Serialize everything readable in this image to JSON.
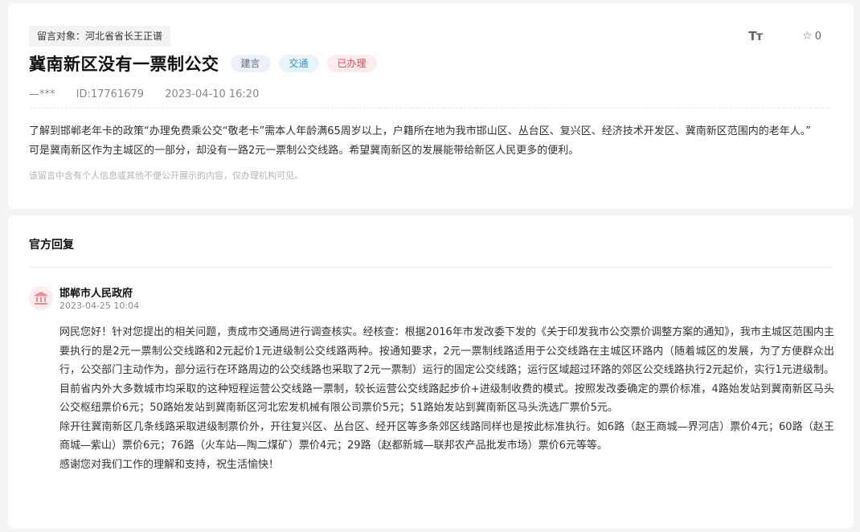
{
  "message": {
    "target": "留言对象：河北省省长王正谱",
    "title": "冀南新区没有一票制公交",
    "tags": {
      "type": "建言",
      "category": "交通",
      "status": "已办理"
    },
    "font_tool_label": "Tт",
    "favorite_count": "0",
    "author": "—***",
    "id": "ID:17761679",
    "time": "2023-04-10 16:20",
    "content": [
      "了解到邯郸老年卡的政策“办理免费乘公交“敬老卡”需本人年龄满65周岁以上，户籍所在地为我市邯山区、丛台区、复兴区、经济技术开发区、冀南新区范围内的老年人。”",
      "可是冀南新区作为主城区的一部分，却没有一路2元一票制公交线路。希望冀南新区的发展能带给新区人民更多的便利。"
    ],
    "privacy_notice": "该留言中含有个人信息或其他不便公开展示的内容，仅办理机构可见。"
  },
  "reply": {
    "section_title": "官方回复",
    "org_name": "邯郸市人民政府",
    "time": "2023-04-25 10:04",
    "paragraphs": [
      "网民您好！针对您提出的相关问题，责成市交通局进行调查核实。经核查：根据2016年市发改委下发的《关于印发我市公交票价调整方案的通知》，我市主城区范围内主要执行的是2元一票制公交线路和2元起价1元进级制公交线路两种。按通知要求，2元一票制线路适用于公交线路在主城区环路内（随着城区的发展，为了方便群众出行，公交部门主动作为，部分运行在环路周边的公交线路也采取了2元一票制）运行的固定公交线路；运行区域超过环路的郊区公交线路执行2元起价，实行1元进级制。目前省内外大多数城市均采取的这种短程运营公交线路一票制，较长运营公交线路起步价+进级制收费的模式。按照发改委确定的票价标准，4路始发站到冀南新区马头公交枢纽票价6元；50路始发站到冀南新区河北宏发机械有限公司票价5元；51路始发站到冀南新区马头洗选厂票价5元。",
      "除开往冀南新区几条线路采取进级制票价外，开往复兴区、丛台区、经开区等多条郊区线路同样也是按此标准执行。如6路（赵王商城—界河店）票价4元；60路（赵王商城—紫山）票价6元；76路（火车站—陶二煤矿）票价4元；29路（赵都新城—联邦农产品批发市场）票价6元等等。",
      "感谢您对我们工作的理解和支持，祝生活愉快！"
    ]
  },
  "colors": {
    "status_red": "#e0474f",
    "category_blue": "#3a8fc7",
    "type_gray": "#5a6b8c",
    "avatar_bg": "#fdecee"
  }
}
